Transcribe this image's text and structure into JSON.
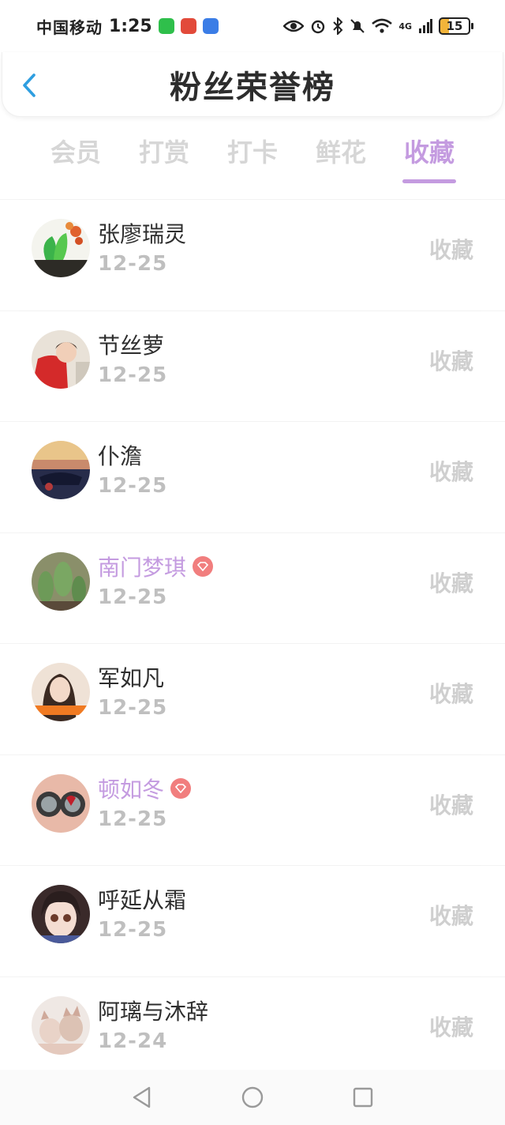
{
  "status_bar": {
    "carrier": "中国移动",
    "time": "1:25",
    "network": "4G",
    "battery": "15",
    "app_icons": [
      {
        "name": "wechat-icon",
        "color": "#2fbf4b"
      },
      {
        "name": "app-red-icon",
        "color": "#e24a3a"
      },
      {
        "name": "voice-app-icon",
        "color": "#3b7de6"
      }
    ]
  },
  "header": {
    "title": "粉丝荣誉榜"
  },
  "tabs": [
    {
      "label": "会员"
    },
    {
      "label": "打赏"
    },
    {
      "label": "打卡"
    },
    {
      "label": "鲜花"
    },
    {
      "label": "收藏"
    }
  ],
  "active_tab": "收藏",
  "colors": {
    "accent": "#c49be0",
    "back": "#2e9ee0",
    "vip_badge": "#f17e7e"
  },
  "fans": [
    {
      "name": "张廖瑞灵",
      "date": "12-25",
      "action": "收藏",
      "vip": false,
      "avatar": "cabbage"
    },
    {
      "name": "节丝萝",
      "date": "12-25",
      "action": "收藏",
      "vip": false,
      "avatar": "red-jacket"
    },
    {
      "name": "仆澹",
      "date": "12-25",
      "action": "收藏",
      "vip": false,
      "avatar": "car-dusk"
    },
    {
      "name": "南门梦琪",
      "date": "12-25",
      "action": "收藏",
      "vip": true,
      "avatar": "cactus"
    },
    {
      "name": "军如凡",
      "date": "12-25",
      "action": "收藏",
      "vip": false,
      "avatar": "girl-portrait"
    },
    {
      "name": "顿如冬",
      "date": "12-25",
      "action": "收藏",
      "vip": true,
      "avatar": "goggles"
    },
    {
      "name": "呼延从霜",
      "date": "12-25",
      "action": "收藏",
      "vip": false,
      "avatar": "doll"
    },
    {
      "name": "阿璃与沐辞",
      "date": "12-24",
      "action": "收藏",
      "vip": false,
      "avatar": "cats"
    }
  ]
}
